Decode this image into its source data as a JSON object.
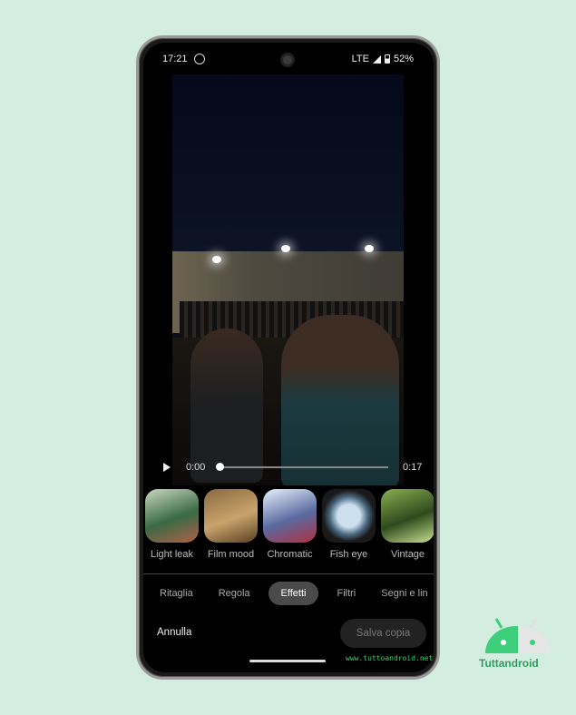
{
  "status": {
    "time": "17:21",
    "network": "LTE",
    "battery": "52%",
    "icons": [
      "whatsapp-icon",
      "signal-icon",
      "battery-icon"
    ]
  },
  "player": {
    "current": "0:00",
    "duration": "0:17",
    "progress": 0
  },
  "effects": [
    {
      "label": "Light leak",
      "colors": [
        "#c8d8c0",
        "#3b6a45",
        "#b0604a"
      ]
    },
    {
      "label": "Film mood",
      "colors": [
        "#8a6a40",
        "#c9a36b",
        "#5a4024"
      ]
    },
    {
      "label": "Chromatic",
      "colors": [
        "#e8f2ff",
        "#5a6aa0",
        "#b03040"
      ]
    },
    {
      "label": "Fish eye",
      "colors": [
        "#cde0f0",
        "#4a6a80",
        "#1a1a1a"
      ]
    },
    {
      "label": "Vintage",
      "colors": [
        "#8ab050",
        "#2e4a1e",
        "#c8e090"
      ]
    }
  ],
  "tabs": [
    {
      "label": "Ritaglia"
    },
    {
      "label": "Regola"
    },
    {
      "label": "Effetti",
      "active": true
    },
    {
      "label": "Filtri"
    },
    {
      "label": "Segni e lin"
    }
  ],
  "actions": {
    "cancel": "Annulla",
    "save": "Salva copia"
  },
  "watermark": "www.tuttoandroid.net",
  "logo": {
    "text": "Tuttandroid",
    "color": "#3ecf7a"
  }
}
